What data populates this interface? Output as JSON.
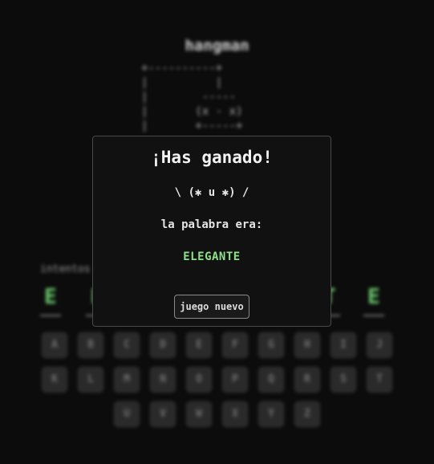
{
  "game": {
    "title": "hangman",
    "gallows_art": "+----------+\n|          |\n|        -----\n|       (x - x)\n|       +-----+",
    "attempts_label": "intentos",
    "word_letters": [
      "E",
      "L",
      "",
      "",
      "",
      "",
      "T",
      "E"
    ],
    "keyboard_rows": [
      [
        "A",
        "B",
        "C",
        "D",
        "E",
        "F",
        "G",
        "H",
        "I",
        "J"
      ],
      [
        "K",
        "L",
        "M",
        "N",
        "O",
        "P",
        "Q",
        "R",
        "S",
        "T"
      ],
      [
        "U",
        "V",
        "W",
        "X",
        "Y",
        "Z"
      ]
    ]
  },
  "modal": {
    "title": "¡Has ganado!",
    "face": "\\ (✱ u ✱) /",
    "label": "la palabra era:",
    "word": "ELEGANTE",
    "new_game_label": "juego nuevo"
  },
  "colors": {
    "background": "#0c0c0c",
    "success_green": "#8ee08a",
    "modal_border": "#4a4a4a"
  }
}
